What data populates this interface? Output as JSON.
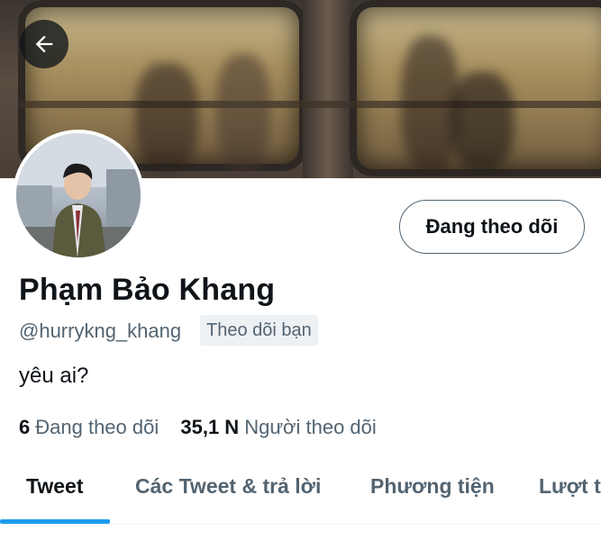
{
  "profile": {
    "name": "Phạm Bảo Khang",
    "handle": "@hurrykng_khang",
    "follows_you_badge": "Theo dõi bạn",
    "bio": "yêu ai?",
    "follow_button_label": "Đang theo dõi"
  },
  "stats": {
    "following_count": "6",
    "following_label": "Đang theo dõi",
    "followers_count": "35,1 N",
    "followers_label": "Người theo dõi"
  },
  "tabs": [
    {
      "label": "Tweet",
      "active": true
    },
    {
      "label": "Các Tweet & trả lời",
      "active": false
    },
    {
      "label": "Phương tiện",
      "active": false
    },
    {
      "label": "Lượt thích",
      "active": false
    }
  ],
  "icons": {
    "back": "arrow-left-icon"
  },
  "colors": {
    "accent": "#1d9bf0",
    "text_primary": "#0f1419",
    "text_secondary": "#536471",
    "badge_bg": "#eef1f4"
  }
}
